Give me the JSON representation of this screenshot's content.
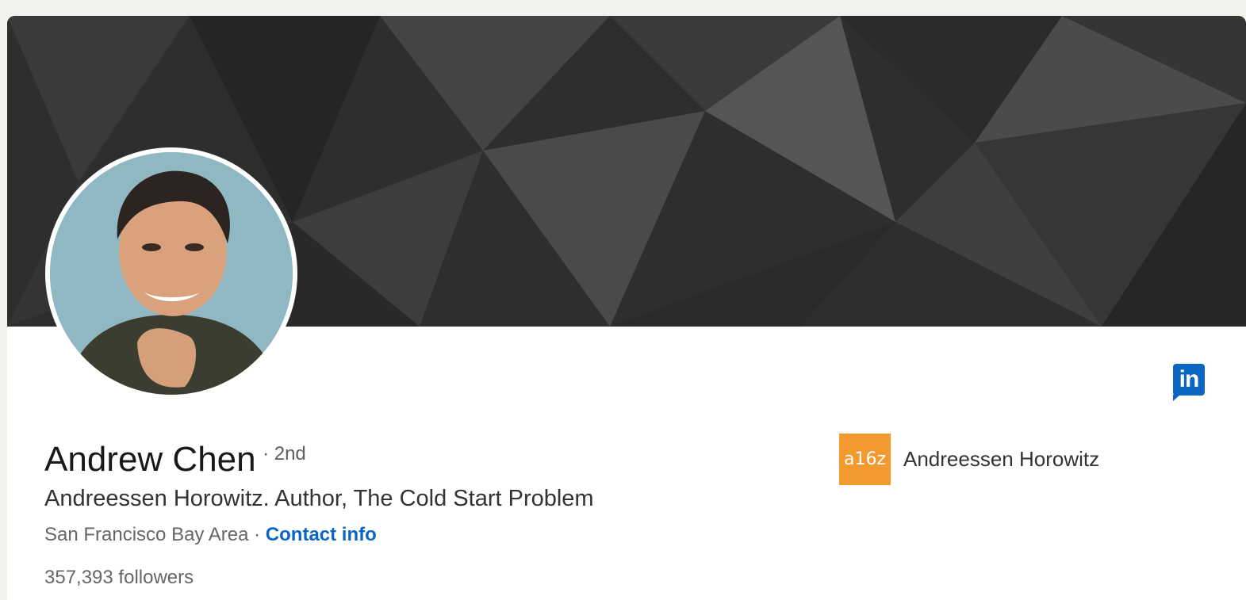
{
  "profile": {
    "name": "Andrew Chen",
    "degree": "· 2nd",
    "headline": "Andreessen Horowitz. Author, The Cold Start Problem",
    "location": "San Francisco Bay Area",
    "location_separator": " · ",
    "contact_label": "Contact info",
    "followers": "357,393 followers"
  },
  "company": {
    "logo_text": "a16z",
    "name": "Andreessen Horowitz"
  },
  "badge": {
    "label": "in"
  },
  "colors": {
    "accent": "#0a66c2",
    "company_logo": "#f39a2f",
    "banner": "#333333"
  }
}
